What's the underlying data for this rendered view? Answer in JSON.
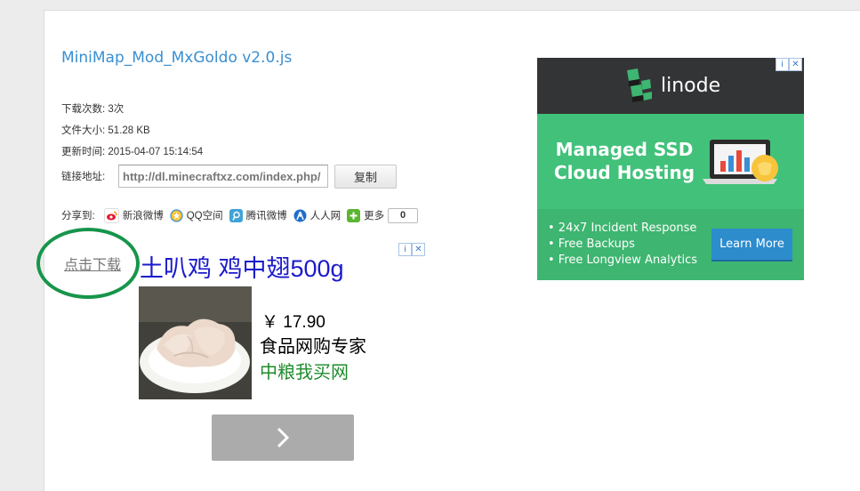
{
  "file": {
    "title": "MiniMap_Mod_MxGoldo v2.0.js",
    "downloads_label": "下载次数:",
    "downloads_value": "3次",
    "size_label": "文件大小:",
    "size_value": "51.28 KB",
    "updated_label": "更新时间:",
    "updated_value": "2015-04-07 15:14:54",
    "link_label": "链接地址:",
    "link_value": "http://dl.minecraftxz.com/index.php/",
    "copy_label": "复制"
  },
  "share": {
    "label": "分享到:",
    "items": [
      {
        "name": "新浪微博",
        "icon": "weibo-icon"
      },
      {
        "name": "QQ空间",
        "icon": "qzone-icon"
      },
      {
        "name": "腾讯微博",
        "icon": "tencent-weibo-icon"
      },
      {
        "name": "人人网",
        "icon": "renren-icon"
      },
      {
        "name": "更多",
        "icon": "plus-icon"
      }
    ],
    "count": "0"
  },
  "download": {
    "label": "点击下载"
  },
  "food_ad": {
    "headline": "土叭鸡 鸡中翅500g",
    "price": "￥ 17.90",
    "desc": "食品网购专家",
    "source": "中粮我买网",
    "adchoice_icon": "adchoices-icon",
    "next_icon": "chevron-right-icon"
  },
  "linode_ad": {
    "brand": "linode",
    "headline_1": "Managed SSD",
    "headline_2": "Cloud Hosting",
    "bullets": [
      "• 24x7 Incident Response",
      "• Free Backups",
      "• Free Longview Analytics"
    ],
    "cta": "Learn More",
    "colors": {
      "dark": "#333435",
      "green": "#42c17a",
      "button": "#2d8ccc"
    }
  }
}
